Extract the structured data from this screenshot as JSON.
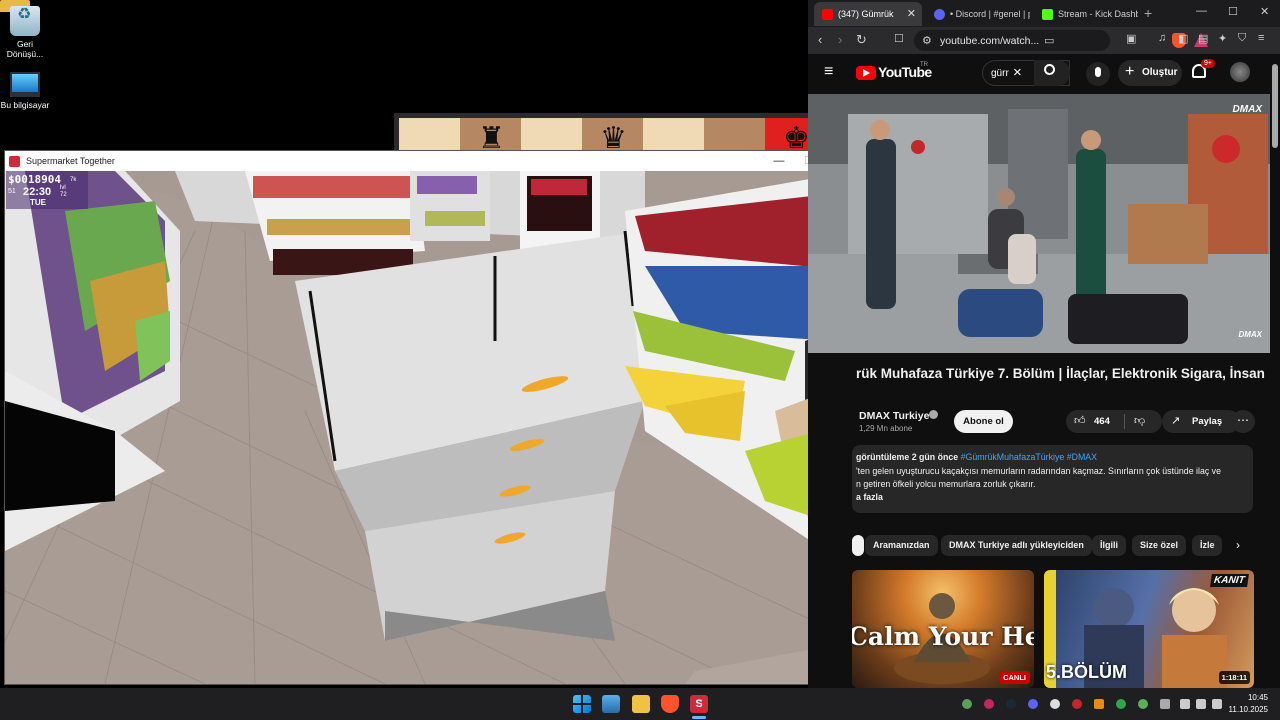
{
  "desktop": {
    "icons": [
      {
        "label": "Geri Dönüşü...",
        "icon": "recycle-bin-icon"
      },
      {
        "label": "Bu bilgisayar",
        "icon": "this-pc-icon"
      }
    ]
  },
  "chess": {
    "pieces": [
      "♜",
      "♛",
      "♚"
    ]
  },
  "game_window": {
    "title": "Supermarket Together",
    "controls": {
      "minimize": "—",
      "maximize": "☐",
      "close": "✕"
    },
    "hud": {
      "money": "$0018904",
      "money_badge": "7k",
      "day": "51",
      "time": "22:30",
      "level_label": "lvl",
      "level": "72",
      "weekday": "TUE"
    }
  },
  "browser": {
    "tabs": [
      {
        "title": "(347) Gümrük",
        "active": true,
        "color": "#ff0000"
      },
      {
        "title": "• Discord | #genel | p",
        "active": false,
        "color": "#5865f2"
      },
      {
        "title": "Stream - Kick Dashbo",
        "active": false,
        "color": "#53fc18"
      }
    ],
    "new_tab": "+",
    "window_controls": {
      "minimize": "—",
      "maximize": "☐",
      "close": "✕"
    },
    "url": "youtube.com/watch..."
  },
  "youtube": {
    "wordmark": "YouTube",
    "region": "TR",
    "search_value": "gürr",
    "create_label": "Oluştur",
    "notifications": "9+",
    "player": {
      "watermark": "DMAX",
      "watermark_small": "DMAX"
    },
    "title": "rük Muhafaza Türkiye 7. Bölüm | İlaçlar, Elektronik Sigara, İnsan",
    "channel": "DMAX Turkiye",
    "subscribers": "1,29 Mn abone",
    "subscribe_label": "Abone ol",
    "likes": "464",
    "share_label": "Paylaş",
    "description": {
      "meta": "görüntüleme  2 gün önce",
      "hashtags": "#GümrükMuhafazaTürkiye #DMAX",
      "line1": "'ten gelen uyuşturucu kaçakçısı memurların radarından kaçmaz. Sınırların çok üstünde ilaç ve",
      "line2": "n getiren öfkeli yolcu memurlara zorluk çıkarır.",
      "more": "a fazla"
    },
    "chips": [
      "",
      "Aramanızdan",
      "DMAX Turkiye adlı yükleyiciden",
      "İlgili",
      "Size özel",
      "İzle"
    ],
    "recommendations": [
      {
        "overlay_text": "Calm Your Heart",
        "badge": "CANLI"
      },
      {
        "overlay_text": "5.BÖLÜM",
        "corner_badge": "KANIT",
        "duration": "1:18:11"
      }
    ]
  },
  "taskbar": {
    "clock_time": "10:45",
    "clock_date": "11.10.2025",
    "game_icon_letter": "S"
  }
}
